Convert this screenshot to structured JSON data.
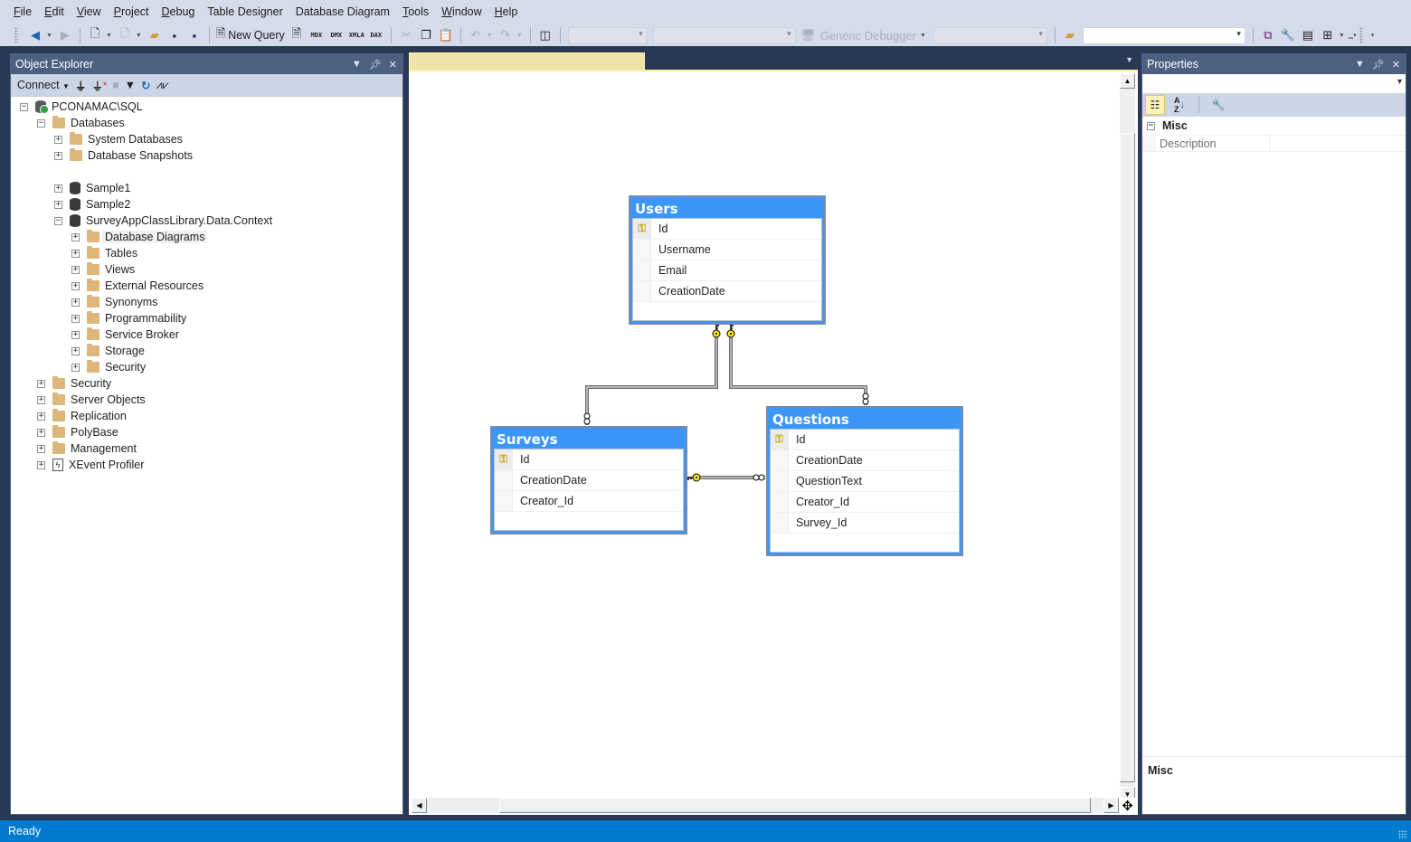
{
  "menu": [
    {
      "label": "File",
      "access": "F",
      "rest": "ile"
    },
    {
      "label": "Edit",
      "access": "E",
      "rest": "dit"
    },
    {
      "label": "View",
      "access": "V",
      "rest": "iew"
    },
    {
      "label": "Project",
      "access": "P",
      "rest": "roject"
    },
    {
      "label": "Debug",
      "access": "D",
      "rest": "ebug"
    },
    {
      "label": "Table Designer"
    },
    {
      "label": "Database Diagram"
    },
    {
      "label": "Tools",
      "access": "T",
      "rest": "ools"
    },
    {
      "label": "Window",
      "access": "W",
      "rest": "indow"
    },
    {
      "label": "Help",
      "access": "H",
      "rest": "elp"
    }
  ],
  "toolbar": {
    "new_query_label": "New Query",
    "mdx_label": "MDX",
    "dmx_label": "DMX",
    "xmla_label": "XMLA",
    "dax_label": "DAX",
    "debugger_label": "Generic Debugger",
    "search_value": ""
  },
  "object_explorer": {
    "title": "Object Explorer",
    "connect_label": "Connect",
    "tree": [
      {
        "label": "PCONAMAC\\SQL",
        "level": 0,
        "icon": "server",
        "state": "expanded"
      },
      {
        "label": "Databases",
        "level": 1,
        "icon": "folder",
        "state": "expanded"
      },
      {
        "label": "System Databases",
        "level": 2,
        "icon": "folder",
        "state": "collapsed"
      },
      {
        "label": "Database Snapshots",
        "level": 2,
        "icon": "folder",
        "state": "collapsed"
      },
      {
        "label": "",
        "level": 2,
        "icon": "none",
        "state": "spacer"
      },
      {
        "label": "Sample1",
        "level": 2,
        "icon": "database",
        "state": "collapsed"
      },
      {
        "label": "Sample2",
        "level": 2,
        "icon": "database",
        "state": "collapsed"
      },
      {
        "label": "SurveyAppClassLibrary.Data.Context",
        "level": 2,
        "icon": "database",
        "state": "expanded"
      },
      {
        "label": "Database Diagrams",
        "level": 3,
        "icon": "folder",
        "state": "collapsed",
        "selected": true
      },
      {
        "label": "Tables",
        "level": 3,
        "icon": "folder",
        "state": "collapsed"
      },
      {
        "label": "Views",
        "level": 3,
        "icon": "folder",
        "state": "collapsed"
      },
      {
        "label": "External Resources",
        "level": 3,
        "icon": "folder",
        "state": "collapsed"
      },
      {
        "label": "Synonyms",
        "level": 3,
        "icon": "folder",
        "state": "collapsed"
      },
      {
        "label": "Programmability",
        "level": 3,
        "icon": "folder",
        "state": "collapsed"
      },
      {
        "label": "Service Broker",
        "level": 3,
        "icon": "folder",
        "state": "collapsed"
      },
      {
        "label": "Storage",
        "level": 3,
        "icon": "folder",
        "state": "collapsed"
      },
      {
        "label": "Security",
        "level": 3,
        "icon": "folder",
        "state": "collapsed"
      },
      {
        "label": "Security",
        "level": 1,
        "icon": "folder",
        "state": "collapsed"
      },
      {
        "label": "Server Objects",
        "level": 1,
        "icon": "folder",
        "state": "collapsed"
      },
      {
        "label": "Replication",
        "level": 1,
        "icon": "folder",
        "state": "collapsed"
      },
      {
        "label": "PolyBase",
        "level": 1,
        "icon": "folder",
        "state": "collapsed"
      },
      {
        "label": "Management",
        "level": 1,
        "icon": "folder",
        "state": "collapsed"
      },
      {
        "label": "XEvent Profiler",
        "level": 1,
        "icon": "xevent",
        "state": "collapsed"
      }
    ]
  },
  "document": {
    "tab_label": ""
  },
  "diagram": {
    "tables": [
      {
        "name": "Users",
        "columns": [
          {
            "name": "Id",
            "pk": true
          },
          {
            "name": "Username",
            "pk": false
          },
          {
            "name": "Email",
            "pk": false
          },
          {
            "name": "CreationDate",
            "pk": false
          }
        ]
      },
      {
        "name": "Surveys",
        "columns": [
          {
            "name": "Id",
            "pk": true
          },
          {
            "name": "CreationDate",
            "pk": false
          },
          {
            "name": "Creator_Id",
            "pk": false
          }
        ]
      },
      {
        "name": "Questions",
        "columns": [
          {
            "name": "Id",
            "pk": true
          },
          {
            "name": "CreationDate",
            "pk": false
          },
          {
            "name": "QuestionText",
            "pk": false
          },
          {
            "name": "Creator_Id",
            "pk": false
          },
          {
            "name": "Survey_Id",
            "pk": false
          }
        ]
      }
    ],
    "relationships": [
      {
        "from": "Users",
        "to": "Surveys",
        "one_end": "key",
        "many_end": "infinity"
      },
      {
        "from": "Users",
        "to": "Questions",
        "one_end": "key",
        "many_end": "infinity"
      },
      {
        "from": "Surveys",
        "to": "Questions",
        "one_end": "key",
        "many_end": "infinity"
      }
    ]
  },
  "properties": {
    "title": "Properties",
    "object_value": "",
    "category": "Misc",
    "rows": [
      {
        "name": "Description",
        "value": ""
      }
    ],
    "description_title": "Misc"
  },
  "status": {
    "text": "Ready"
  },
  "colors": {
    "chrome": "#293955",
    "panel_header": "#4d6082",
    "status_bar": "#007acc",
    "table_header": "#3c96f8",
    "key_yellow": "#f5e50a"
  }
}
